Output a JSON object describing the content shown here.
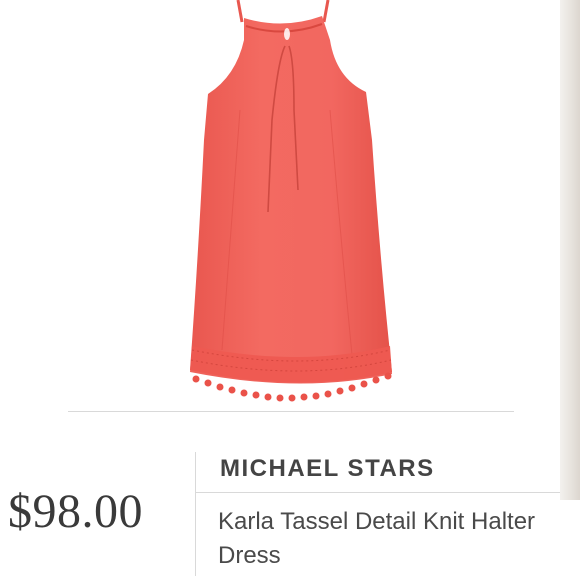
{
  "product": {
    "brand": "MICHAEL STARS",
    "price": "$98.00",
    "name": "Karla Tassel Detail Knit Halter Dress",
    "image": {
      "alt": "Coral halter dress with tassel trim hem",
      "dress_color": "#f0625a"
    }
  },
  "colors": {
    "text_dark": "#3a3a3a",
    "divider": "#d9d9d9",
    "background": "#ffffff"
  }
}
